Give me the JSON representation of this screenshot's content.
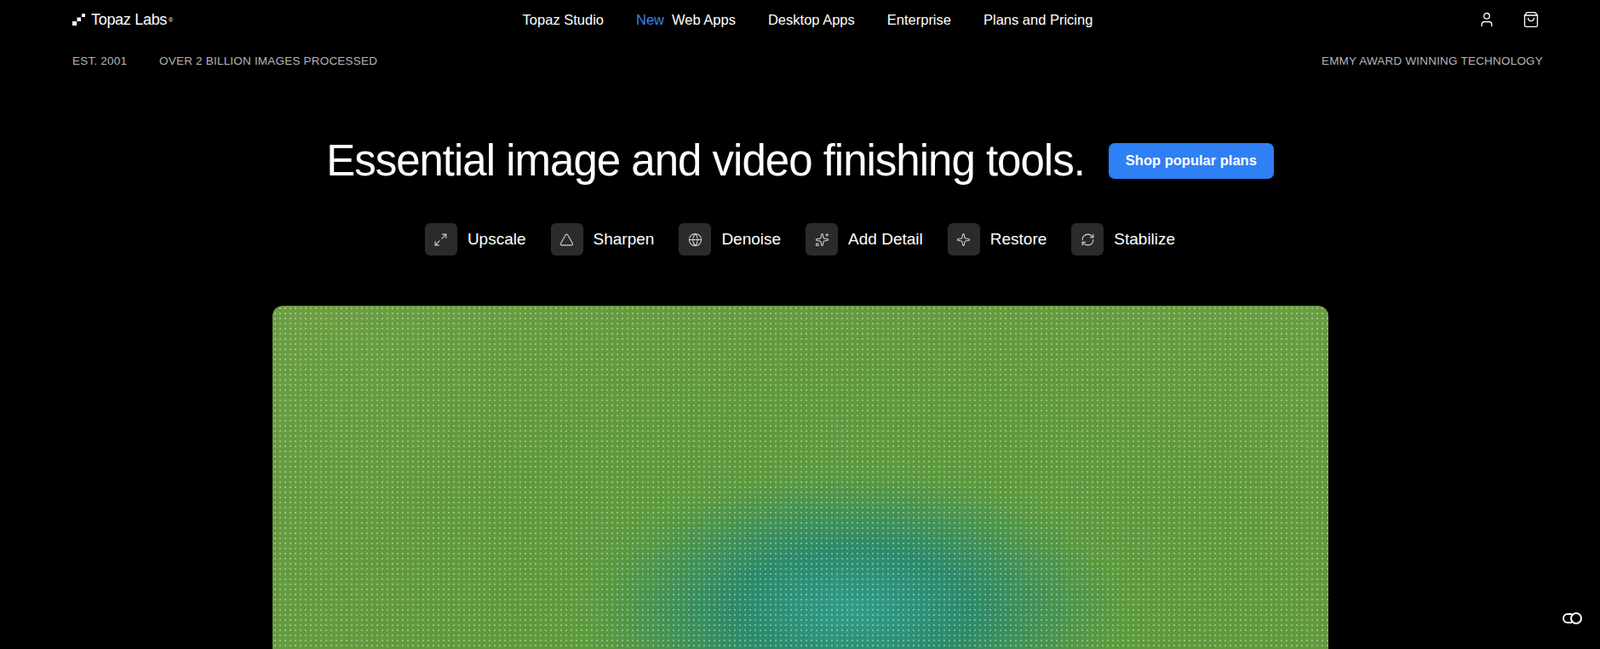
{
  "header": {
    "logo": {
      "name": "Topaz Labs",
      "mark": "®"
    },
    "nav": [
      {
        "label": "Topaz Studio",
        "badge": ""
      },
      {
        "label": "Web Apps",
        "badge": "New"
      },
      {
        "label": "Desktop Apps",
        "badge": ""
      },
      {
        "label": "Enterprise",
        "badge": ""
      },
      {
        "label": "Plans and Pricing",
        "badge": ""
      }
    ]
  },
  "stats": {
    "left": [
      "EST. 2001",
      "OVER 2 BILLION IMAGES PROCESSED"
    ],
    "right": "EMMY AWARD WINNING TECHNOLOGY"
  },
  "hero": {
    "headline": "Essential image and video finishing tools.",
    "button": "Shop popular plans",
    "features": [
      "Upscale",
      "Sharpen",
      "Denoise",
      "Add Detail",
      "Restore",
      "Stabilize"
    ]
  }
}
